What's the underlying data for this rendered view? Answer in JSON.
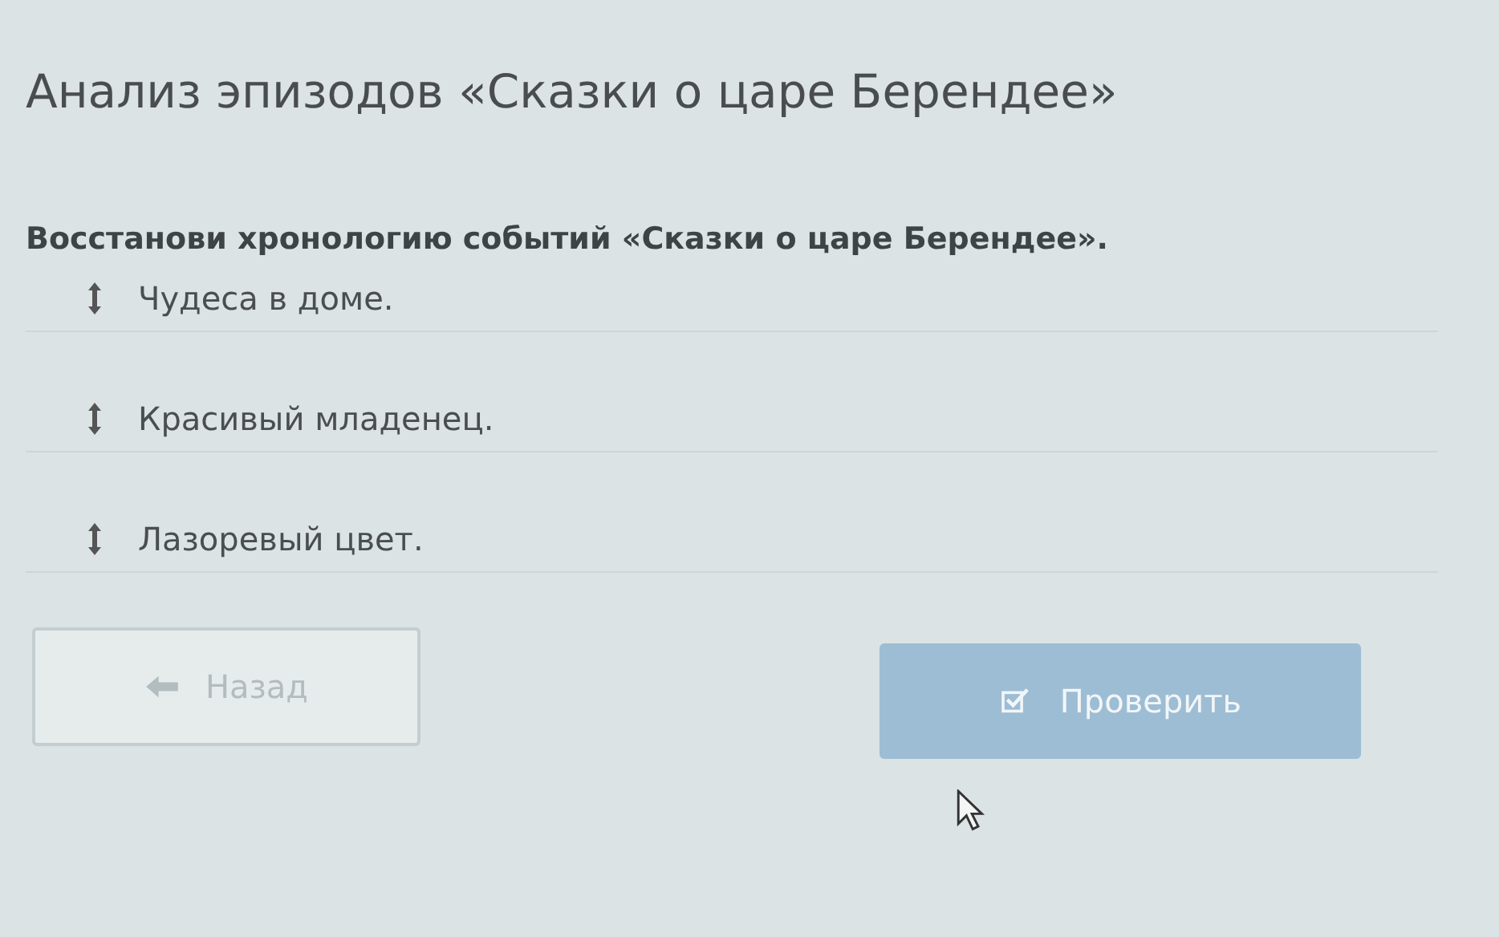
{
  "title": "Анализ эпизодов «Сказки о царе Берендее»",
  "question": "Восстанови хронологию событий «Сказки о царе Берендее».",
  "items": [
    {
      "text": "Чудеса в доме."
    },
    {
      "text": "Красивый младенец."
    },
    {
      "text": "Лазоревый цвет."
    }
  ],
  "buttons": [
    {
      "kind": "back",
      "label": "Назад",
      "disabled": true
    },
    {
      "kind": "check",
      "label": "Проверить",
      "disabled": true
    }
  ]
}
